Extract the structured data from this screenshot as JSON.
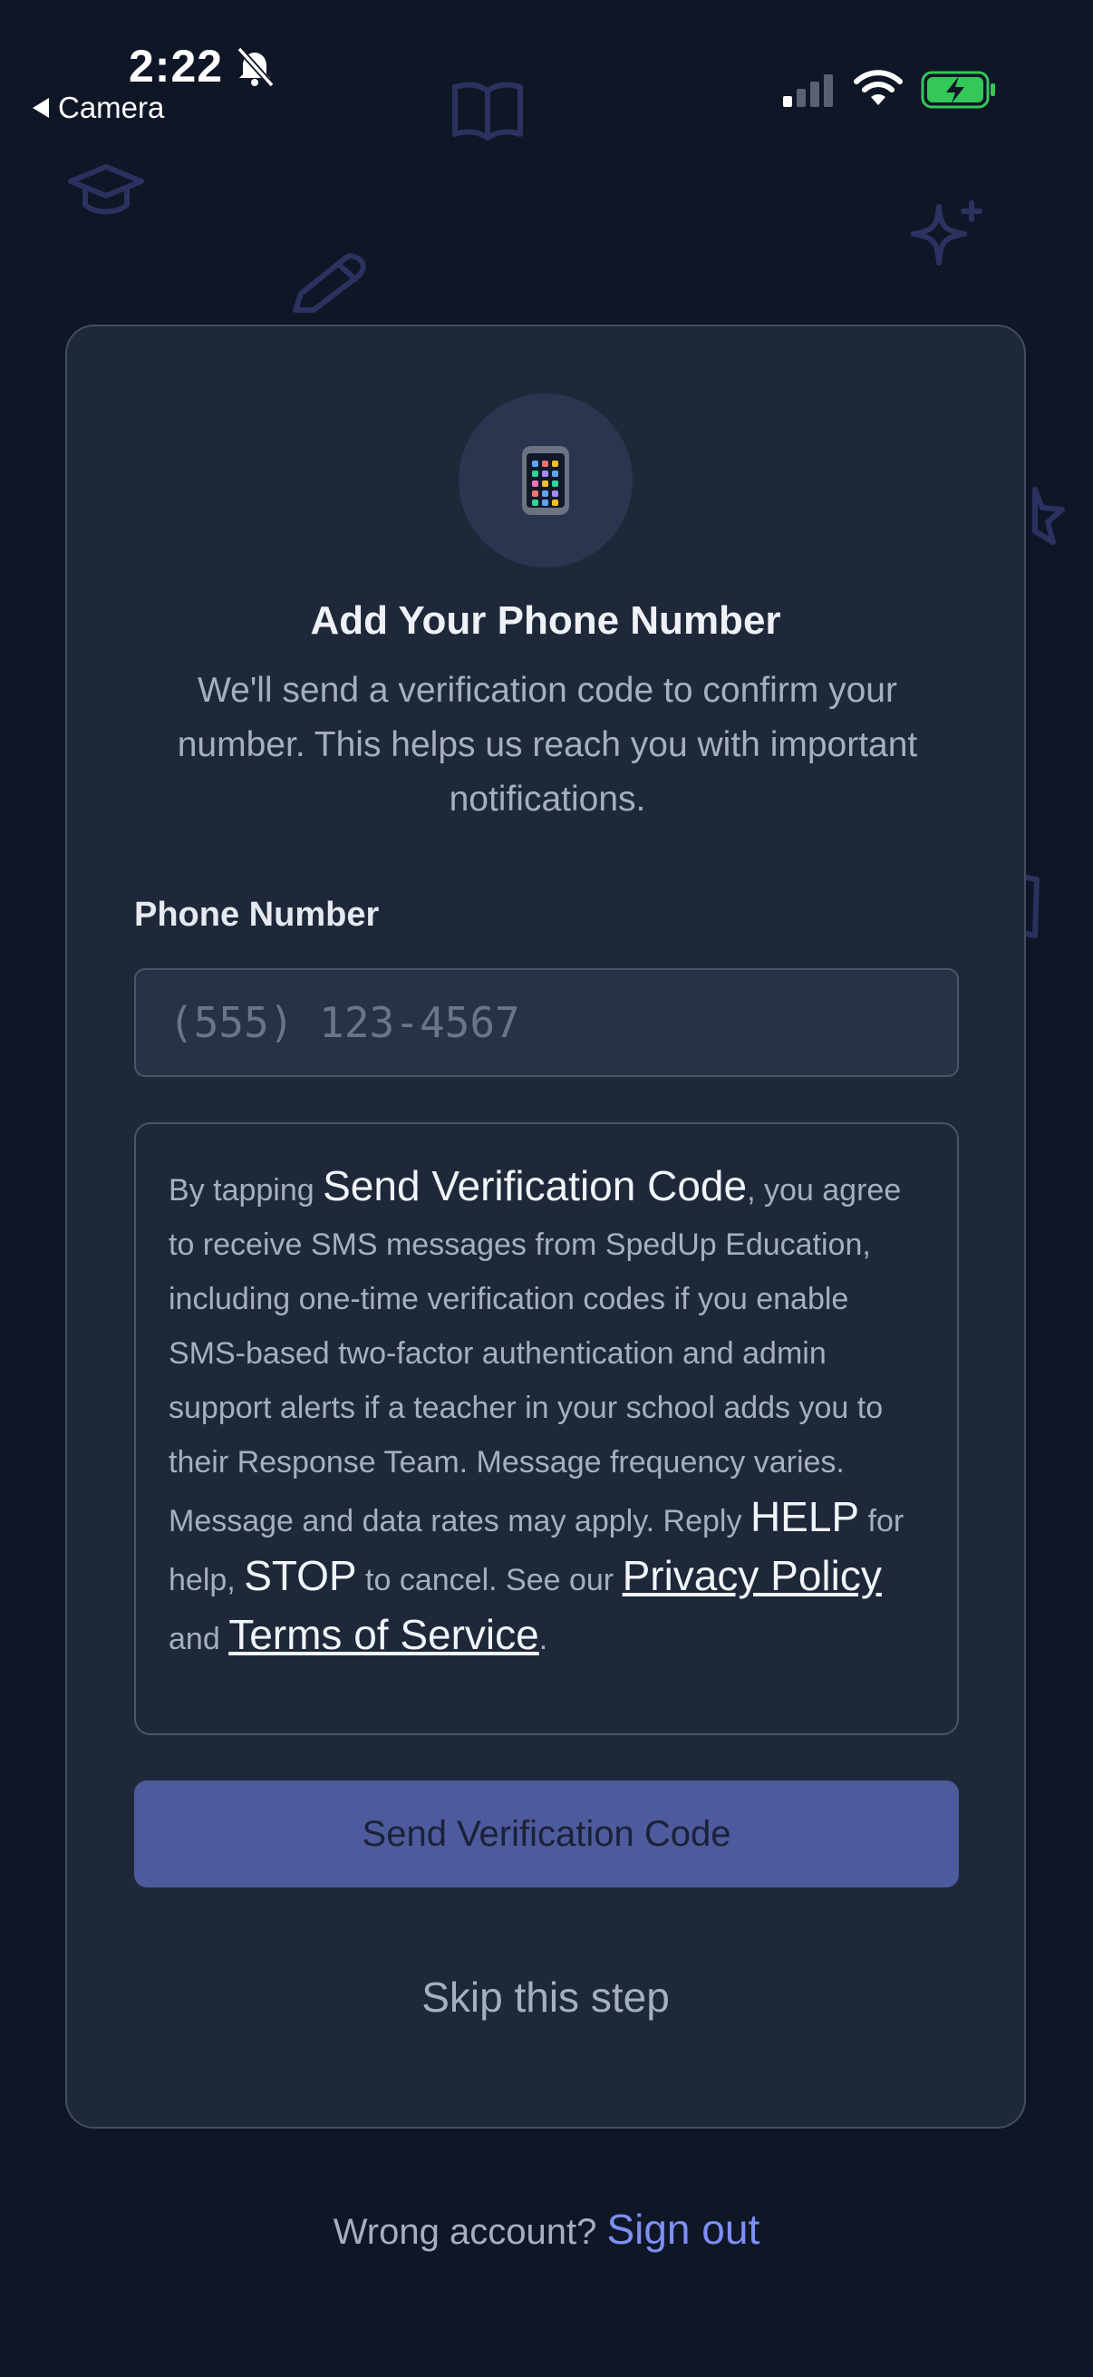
{
  "status_bar": {
    "time": "2:22",
    "back_label": "Camera"
  },
  "card": {
    "icon": "mobile-phone-emoji",
    "title": "Add Your Phone Number",
    "subtitle": "We'll send a verification code to confirm your number. This helps us reach you with important notifications.",
    "phone_label": "Phone Number",
    "phone_placeholder": "(555) 123-4567",
    "phone_value": "",
    "consent": {
      "prefix": "By tapping ",
      "button_ref": "Send Verification Code",
      "body": ", you agree to receive SMS messages from SpedUp Education, including one-time verification codes if you enable SMS-based two-factor authentication and admin support alerts if a teacher in your school adds you to their Response Team. Message frequency varies. Message and data rates may apply. Reply ",
      "help_word": "HELP",
      "mid": " for help, ",
      "stop_word": "STOP",
      "cancel_text": " to cancel. See our ",
      "privacy_link": "Privacy Policy",
      "and_text": " and ",
      "terms_link": "Terms of Service",
      "end": "."
    },
    "send_button": "Send Verification Code",
    "skip_link": "Skip this step"
  },
  "footer": {
    "prompt": "Wrong account? ",
    "signout": "Sign out"
  },
  "colors": {
    "background": "#0f1626",
    "card": "#1e2839",
    "button": "#4d5a9c",
    "link": "#7d8ef5",
    "battery": "#34c759"
  }
}
